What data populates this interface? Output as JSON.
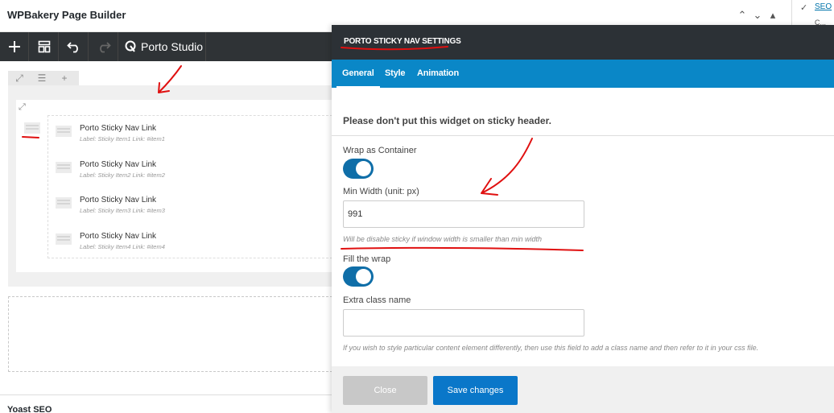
{
  "builder": {
    "title": "WPBakery Page Builder",
    "studio_label": "Porto Studio",
    "toolbar_icons": [
      "plus-icon",
      "layout-icon",
      "undo-icon",
      "redo-icon"
    ]
  },
  "nav_links": [
    {
      "title": "Porto Sticky Nav Link",
      "sub": "Label: Sticky Item1  Link: #item1"
    },
    {
      "title": "Porto Sticky Nav Link",
      "sub": "Label: Sticky Item2  Link: #item2"
    },
    {
      "title": "Porto Sticky Nav Link",
      "sub": "Label: Sticky Item3  Link: #item3"
    },
    {
      "title": "Porto Sticky Nav Link",
      "sub": "Label: Sticky Item4  Link: #item4"
    }
  ],
  "yoast": {
    "title": "Yoast SEO"
  },
  "sidebar": {
    "seo_link": "SEO",
    "seo_sub": "C..."
  },
  "modal": {
    "title": "PORTO STICKY NAV SETTINGS",
    "tabs": [
      "General",
      "Style",
      "Animation"
    ],
    "active_tab": "General",
    "warning": "Please don't put this widget on sticky header.",
    "wrap_label": "Wrap as Container",
    "wrap_on": true,
    "min_width_label": "Min Width (unit: px)",
    "min_width_value": "991",
    "min_width_help": "Will be disable sticky if window width is smaller than min width",
    "fill_label": "Fill the wrap",
    "fill_on": true,
    "extra_class_label": "Extra class name",
    "extra_class_value": "",
    "extra_class_help": "If you wish to style particular content element differently, then use this field to add a class name and then refer to it in your css file.",
    "close_label": "Close",
    "save_label": "Save changes"
  },
  "colors": {
    "toolbar": "#2f3336",
    "tabs": "#0a87c7",
    "toggle": "#0f6ea8",
    "save": "#0a77c9",
    "annotation": "#e01010"
  }
}
